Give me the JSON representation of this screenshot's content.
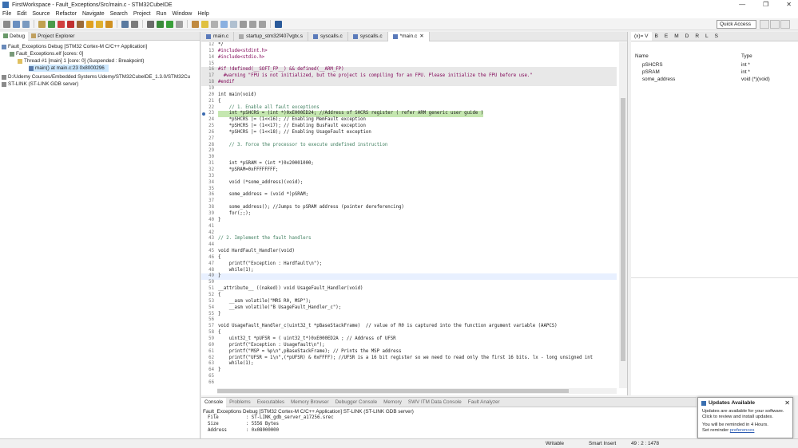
{
  "window": {
    "title": "FirstWorkspace - Fault_Exceptions/Src/main.c - STM32CubeIDE",
    "minimize": "—",
    "maximize": "❐",
    "close": "✕"
  },
  "menu": [
    "File",
    "Edit",
    "Source",
    "Refactor",
    "Navigate",
    "Search",
    "Project",
    "Run",
    "Window",
    "Help"
  ],
  "toolbar": {
    "quick_access_placeholder": "Quick Access"
  },
  "debug_panel": {
    "tabs": [
      "Debug",
      "Project Explorer"
    ],
    "tree": [
      "Fault_Exceptions Debug [STM32 Cortex-M C/C++ Application]",
      "Fault_Exceptions.elf [cores: 0]",
      "Thread #1 [main] 1 [core: 0] (Suspended : Breakpoint)",
      "main() at main.c:23 0x8000296",
      "D:/Udemy Courses/Embedded Systems Udemy/STM32CubeIDE_1.3.0/STM32Cu",
      "ST-LINK (ST-LINK GDB server)"
    ]
  },
  "editor": {
    "tabs": [
      "main.c",
      "startup_stm32f407vgtx.s",
      "syscalls.c",
      "syscalls.c",
      "*main.c"
    ],
    "lines": [
      {
        "n": "12",
        "t": "*/"
      },
      {
        "n": "13",
        "t": "#include<stdint.h>"
      },
      {
        "n": "14",
        "t": "#include<stdio.h>"
      },
      {
        "n": "15",
        "t": ""
      },
      {
        "n": "16",
        "t": "#if !defined(__SOFT_FP__) && defined(__ARM_FP)"
      },
      {
        "n": "17",
        "t": "  #warning \"FPU is not initialized, but the project is compiling for an FPU. Please initialize the FPU before use.\""
      },
      {
        "n": "18",
        "t": "#endif"
      },
      {
        "n": "19",
        "t": ""
      },
      {
        "n": "20",
        "t": "int main(void)"
      },
      {
        "n": "21",
        "t": "{"
      },
      {
        "n": "22",
        "t": "    // 1. Enable all fault exceptions"
      },
      {
        "n": "23",
        "t": "    int *pSHCRS = (int *)0xE000ED24; //Address of SHCRS register ( refer ARM generic user guide )"
      },
      {
        "n": "24",
        "t": "    *pSHCRS |= (1<<16); // Enabling MemFault exception"
      },
      {
        "n": "25",
        "t": "    *pSHCRS |= (1<<17); // Enabling BusFault exception"
      },
      {
        "n": "26",
        "t": "    *pSHCRS |= (1<<18); // Enabling UsageFault exception"
      },
      {
        "n": "27",
        "t": ""
      },
      {
        "n": "28",
        "t": "    // 3. Force the processor to execute undefined instruction"
      },
      {
        "n": "29",
        "t": ""
      },
      {
        "n": "30",
        "t": ""
      },
      {
        "n": "31",
        "t": "    int *pSRAM = (int *)0x20001000;"
      },
      {
        "n": "32",
        "t": "    *pSRAM=0xFFFFFFFF;"
      },
      {
        "n": "33",
        "t": ""
      },
      {
        "n": "34",
        "t": "    void (*some_address)(void);"
      },
      {
        "n": "35",
        "t": ""
      },
      {
        "n": "36",
        "t": "    some_address = (void *)pSRAM;"
      },
      {
        "n": "37",
        "t": ""
      },
      {
        "n": "38",
        "t": "    some_address(); //Jumps to pSRAM address (pointer dereferencing)"
      },
      {
        "n": "39",
        "t": "    for(;;);"
      },
      {
        "n": "40",
        "t": "}"
      },
      {
        "n": "41",
        "t": ""
      },
      {
        "n": "42",
        "t": ""
      },
      {
        "n": "43",
        "t": "// 2. Implement the fault handlers"
      },
      {
        "n": "44",
        "t": ""
      },
      {
        "n": "45",
        "t": "void HardFault_Handler(void)"
      },
      {
        "n": "46",
        "t": "{"
      },
      {
        "n": "47",
        "t": "    printf(\"Exception : Hardfault\\n\");"
      },
      {
        "n": "48",
        "t": "    while(1);"
      },
      {
        "n": "49",
        "t": "}"
      },
      {
        "n": "50",
        "t": ""
      },
      {
        "n": "51",
        "t": "__attribute__ ((naked)) void UsageFault_Handler(void)"
      },
      {
        "n": "52",
        "t": "{"
      },
      {
        "n": "53",
        "t": "    __asm volatile(\"MRS R0, MSP\");"
      },
      {
        "n": "54",
        "t": "    __asm volatile(\"B UsageFault_Handler_c\");"
      },
      {
        "n": "55",
        "t": "}"
      },
      {
        "n": "56",
        "t": ""
      },
      {
        "n": "57",
        "t": "void UsageFault_Handler_c(uint32_t *pBaseStackFrame)  // value of R0 is captured into the function argument variable (AAPCS)"
      },
      {
        "n": "58",
        "t": "{"
      },
      {
        "n": "59",
        "t": "    uint32_t *pUFSR = ( uint32_t*)0xE000ED2A ; // Address of UFSR"
      },
      {
        "n": "60",
        "t": "    printf(\"Exception : Usagefault\\n\");"
      },
      {
        "n": "61",
        "t": "    printf(\"MSP = %p\\n\",pBaseStackFrame); // Prints the MSP address"
      },
      {
        "n": "62",
        "t": "    printf(\"UFSR = 1\\n\",(*pUFSR) & 0xFFFF); //UFSR is a 16 bit register so we need to read only the first 16 bits. lx - long unsigned int"
      },
      {
        "n": "63",
        "t": "    while(1);"
      },
      {
        "n": "64",
        "t": "}"
      },
      {
        "n": "65",
        "t": ""
      },
      {
        "n": "66",
        "t": ""
      }
    ]
  },
  "variables": {
    "tabs": [
      "(x)= V",
      "B",
      "E",
      "M",
      "D",
      "R",
      "L",
      "S"
    ],
    "col_name": "Name",
    "col_type": "Type",
    "rows": [
      {
        "name": "pSHCRS",
        "type": "int *"
      },
      {
        "name": "pSRAM",
        "type": "int *"
      },
      {
        "name": "some_address",
        "type": "void (*)(void)"
      }
    ]
  },
  "console": {
    "tabs": [
      "Console",
      "Problems",
      "Executables",
      "Memory Browser",
      "Debugger Console",
      "Memory",
      "SWV ITM Data Console",
      "Fault Analyzer"
    ],
    "header": "Fault_Exceptions Debug [STM32 Cortex-M C/C++ Application] ST-LINK (ST-LINK GDB server)",
    "lines": [
      "File          : ST-LINK_gdb_server_a17256.srec",
      "Size          : 5556 Bytes",
      "Address       : 0x08000000"
    ]
  },
  "popup": {
    "title": "Updates Available",
    "line1": "Updates are available for your software.",
    "line2": "Click to review and install updates.",
    "line3": "You will be reminded in 4 Hours.",
    "line4_prefix": "Set reminder ",
    "link": "preferences"
  },
  "status": {
    "writable": "Writable",
    "insert": "Smart Insert",
    "position": "49 : 2 : 1478"
  },
  "colors": {
    "breakpoint_line": "#c5e7b0",
    "preprocessor_bg": "#e8e8e8",
    "keyword": "#7f0055",
    "comment": "#3f7f5f",
    "string": "#2a00ff",
    "selection": "#cde8ff"
  }
}
